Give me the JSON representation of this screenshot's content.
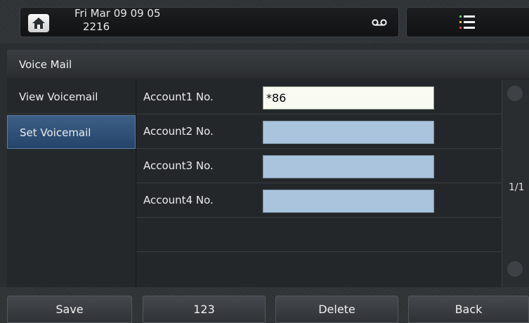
{
  "status": {
    "date_line": "Fri Mar 09 09 05",
    "extension": "2216"
  },
  "icons": {
    "home": "home-icon",
    "voicemail": "voicemail-icon",
    "menu": "menu-list-icon"
  },
  "title": "Voice Mail",
  "sidebar": {
    "items": [
      {
        "label": "View Voicemail",
        "selected": false
      },
      {
        "label": "Set Voicemail",
        "selected": true
      }
    ]
  },
  "fields": [
    {
      "label": "Account1 No.",
      "value": "*86"
    },
    {
      "label": "Account2 No.",
      "value": ""
    },
    {
      "label": "Account3 No.",
      "value": ""
    },
    {
      "label": "Account4 No.",
      "value": ""
    }
  ],
  "pagination": "1/1",
  "softkeys": {
    "save": "Save",
    "input_mode": "123",
    "delete": "Delete",
    "back": "Back"
  },
  "colors": {
    "selected_item": "#2f5077",
    "active_field": "#f9fbf3",
    "inactive_field": "#a9c4dc"
  }
}
